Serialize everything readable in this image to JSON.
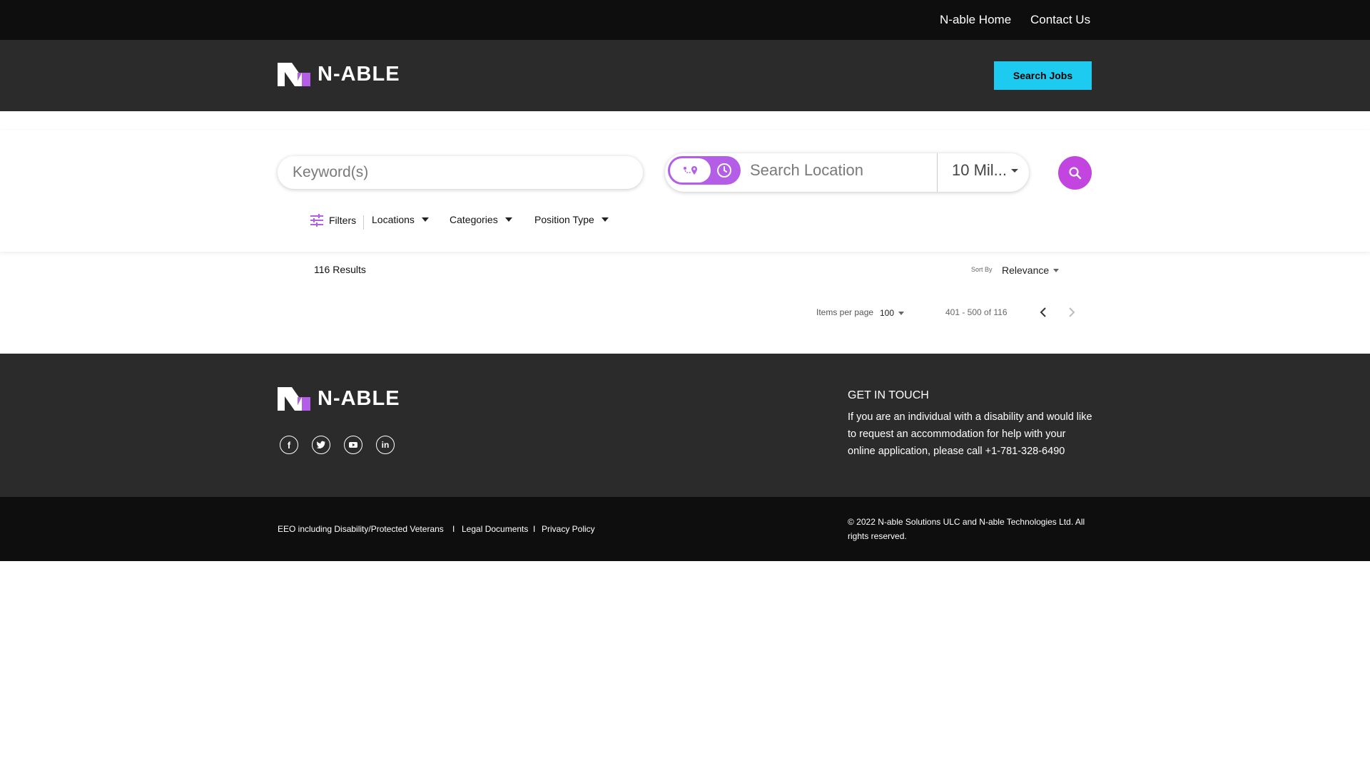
{
  "topnav": {
    "home": "N-able Home",
    "contact": "Contact Us"
  },
  "header": {
    "logo_text": "N-ABLE",
    "search_jobs": "Search Jobs"
  },
  "search": {
    "keyword_placeholder": "Keyword(s)",
    "location_placeholder": "Search Location",
    "radius": "10 Mil..."
  },
  "filters": {
    "label": "Filters",
    "locations": "Locations",
    "categories": "Categories",
    "position_type": "Position Type"
  },
  "results": {
    "count": "116 Results",
    "sort_by": "Sort By",
    "sort_value": "Relevance",
    "items_per_page_label": "Items per page",
    "items_per_page": "100",
    "range": "401 - 500 of 116"
  },
  "footer": {
    "logo_text": "N-ABLE",
    "social": [
      "facebook-icon",
      "twitter-icon",
      "youtube-icon",
      "linkedin-icon"
    ],
    "get_in_touch_title": "GET IN TOUCH",
    "get_in_touch_text": "If you are an individual with a disability and would like to request an accommodation for help with your online application, please call +1-781-328-6490"
  },
  "bottom": {
    "links": [
      "EEO including Disability/Protected Veterans",
      "Legal Documents",
      "Privacy Policy"
    ],
    "separator": "I",
    "copyright": "© 2022 N-able Solutions ULC and N-able Technologies Ltd. All rights reserved."
  },
  "colors": {
    "accent_purple": "#c345e0",
    "cyan": "#1ecbf0",
    "dark": "#2b2b2b",
    "black": "#0e0e0e"
  }
}
